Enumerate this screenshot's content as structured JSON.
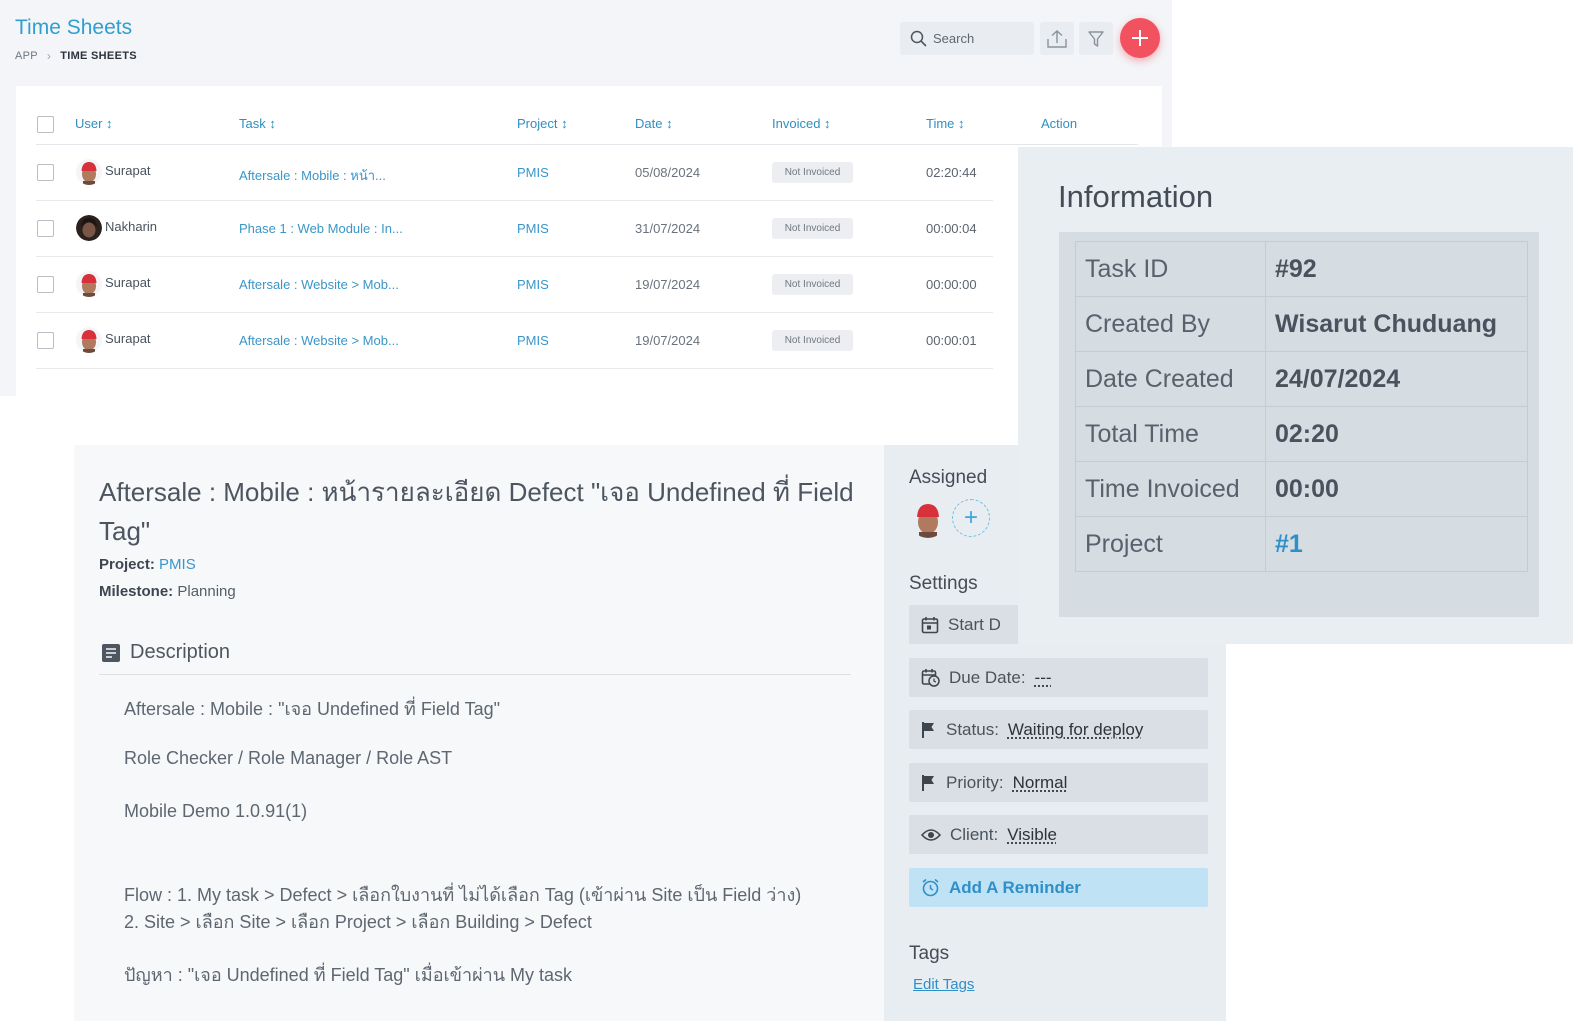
{
  "timesheets": {
    "title": "Time Sheets",
    "breadcrumb": {
      "app": "APP",
      "current": "TIME SHEETS"
    },
    "search_placeholder": "Search",
    "columns": {
      "user": "User ↕",
      "task": "Task ↕",
      "project": "Project ↕",
      "date": "Date ↕",
      "invoiced": "Invoiced ↕",
      "time": "Time ↕",
      "action": "Action"
    },
    "rows": [
      {
        "user": "Surapat",
        "task": "Aftersale : Mobile : หน้า...",
        "project": "PMIS",
        "date": "05/08/2024",
        "invoiced": "Not Invoiced",
        "time": "02:20:44"
      },
      {
        "user": "Nakharin",
        "task": "Phase 1 : Web Module : In...",
        "project": "PMIS",
        "date": "31/07/2024",
        "invoiced": "Not Invoiced",
        "time": "00:00:04"
      },
      {
        "user": "Surapat",
        "task": "Aftersale : Website > Mob...",
        "project": "PMIS",
        "date": "19/07/2024",
        "invoiced": "Not Invoiced",
        "time": "00:00:00"
      },
      {
        "user": "Surapat",
        "task": "Aftersale : Website > Mob...",
        "project": "PMIS",
        "date": "19/07/2024",
        "invoiced": "Not Invoiced",
        "time": "00:00:01"
      }
    ]
  },
  "task": {
    "title": "Aftersale : Mobile : หน้ารายละเอียด Defect \"เจอ Undefined ที่ Field Tag\"",
    "project_label": "Project:",
    "project": "PMIS",
    "milestone_label": "Milestone:",
    "milestone": "Planning",
    "description_heading": "Description",
    "description": [
      "Aftersale : Mobile : \"เจอ Undefined ที่ Field Tag\"",
      "Role Checker / Role Manager / Role AST",
      "Mobile Demo 1.0.91(1)",
      "Flow : 1. My task > Defect > เลือกใบงานที่ ไม่ได้เลือก Tag (เข้าผ่าน Site เป็น Field ว่าง)",
      "2. Site > เลือก Site > เลือก Project > เลือก Building > Defect",
      "ปัญหา : \"เจอ Undefined ที่ Field Tag\" เมื่อเข้าผ่าน My task"
    ]
  },
  "sidebar": {
    "assigned_heading": "Assigned",
    "settings_heading": "Settings",
    "start_label": "Start D",
    "due_label": "Due Date:",
    "due_value": "---",
    "status_label": "Status:",
    "status_value": "Waiting for deploy",
    "priority_label": "Priority:",
    "priority_value": "Normal",
    "client_label": "Client:",
    "client_value": "Visible",
    "reminder_label": "Add A Reminder",
    "tags_heading": "Tags",
    "edit_tags": "Edit Tags"
  },
  "information": {
    "title": "Information",
    "rows": [
      {
        "key": "Task ID",
        "value": "#92"
      },
      {
        "key": "Created By",
        "value": "Wisarut Chuduang"
      },
      {
        "key": "Date Created",
        "value": "24/07/2024"
      },
      {
        "key": "Total Time",
        "value": "02:20"
      },
      {
        "key": "Time Invoiced",
        "value": "00:00"
      },
      {
        "key": "Project",
        "value": "#1"
      }
    ]
  },
  "colors": {
    "accent": "#2f9fcf",
    "add_button": "#f2525f",
    "reminder_bg": "#bfe3f5"
  },
  "icons": [
    "search-icon",
    "export-icon",
    "filter-icon",
    "plus-icon",
    "description-icon",
    "calendar-icon",
    "calendar-clock-icon",
    "flag-icon",
    "eye-icon",
    "alarm-icon"
  ]
}
